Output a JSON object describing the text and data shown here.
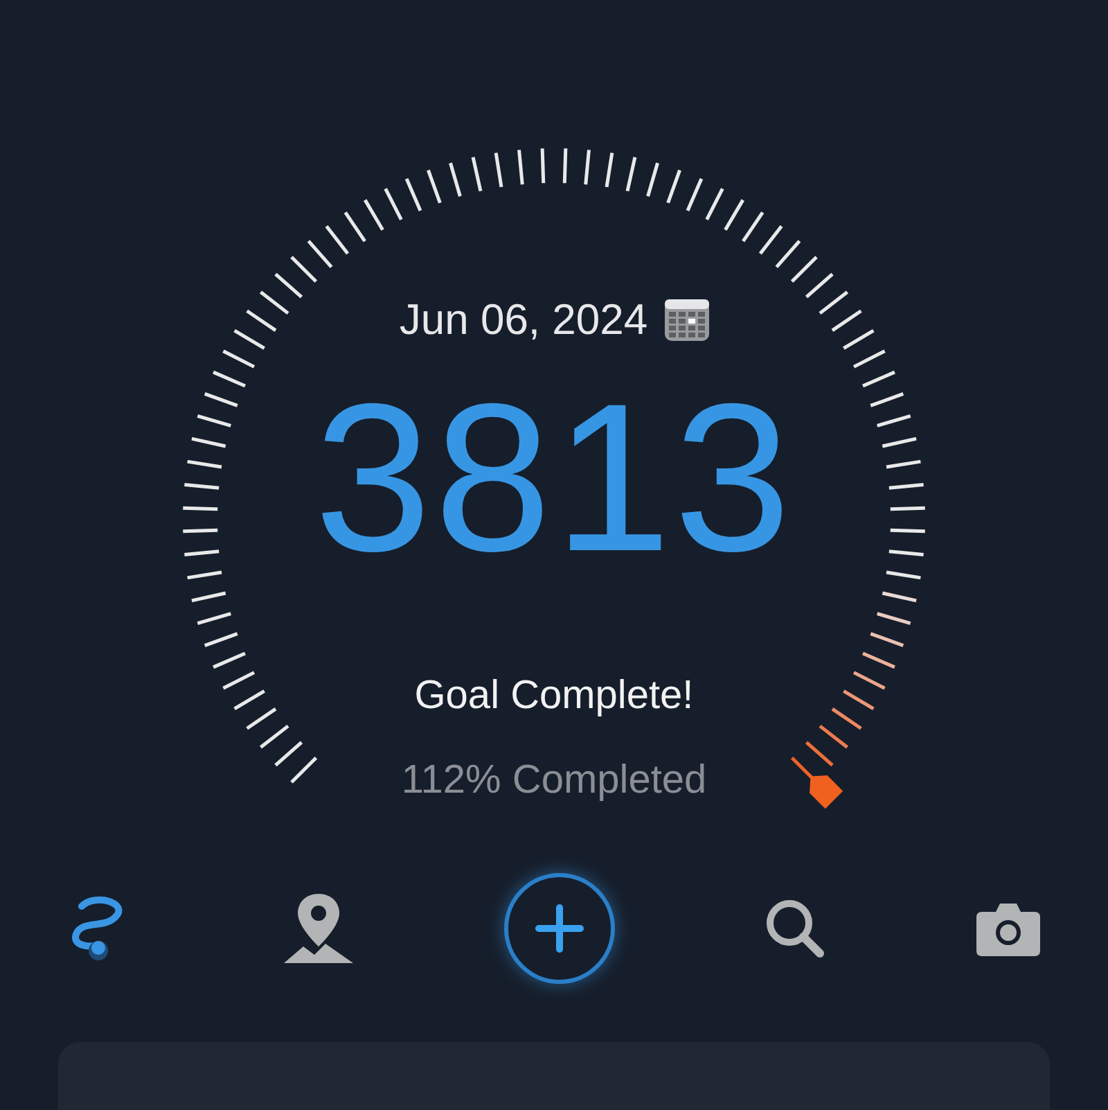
{
  "gauge": {
    "date": "Jun 06, 2024",
    "steps": "3813",
    "status": "Goal Complete!",
    "progress": "112% Completed"
  },
  "nav": [
    {
      "kind": "route",
      "selected": true
    },
    {
      "kind": "map",
      "selected": false
    },
    {
      "kind": "add",
      "selected": false
    },
    {
      "kind": "search",
      "selected": false
    },
    {
      "kind": "camera",
      "selected": false
    }
  ]
}
